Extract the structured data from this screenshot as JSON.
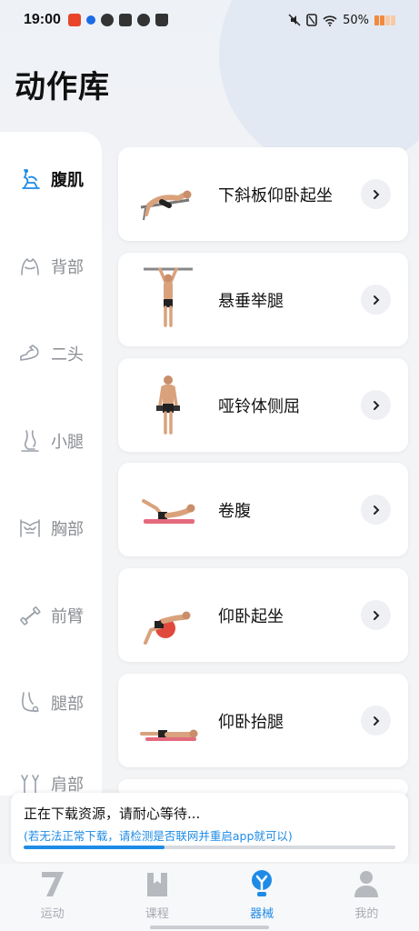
{
  "status_bar": {
    "time": "19:00",
    "battery": "50%"
  },
  "page": {
    "title": "动作库"
  },
  "categories": [
    {
      "label": "腹肌",
      "icon": "abs-icon",
      "active": true
    },
    {
      "label": "背部",
      "icon": "back-icon",
      "active": false
    },
    {
      "label": "二头",
      "icon": "biceps-icon",
      "active": false
    },
    {
      "label": "小腿",
      "icon": "calf-icon",
      "active": false
    },
    {
      "label": "胸部",
      "icon": "chest-icon",
      "active": false
    },
    {
      "label": "前臂",
      "icon": "forearm-icon",
      "active": false
    },
    {
      "label": "腿部",
      "icon": "leg-icon",
      "active": false
    },
    {
      "label": "肩部",
      "icon": "shoulder-icon",
      "active": false
    }
  ],
  "exercises": [
    {
      "name": "下斜板仰卧起坐",
      "thumb": "decline-situp-figure"
    },
    {
      "name": "悬垂举腿",
      "thumb": "hanging-leg-raise-figure"
    },
    {
      "name": "哑铃体侧屈",
      "thumb": "dumbbell-side-bend-figure"
    },
    {
      "name": "卷腹",
      "thumb": "crunch-figure"
    },
    {
      "name": "仰卧起坐",
      "thumb": "ball-situp-figure"
    },
    {
      "name": "仰卧抬腿",
      "thumb": "lying-leg-raise-figure"
    }
  ],
  "download": {
    "title": "正在下载资源，请耐心等待...",
    "hint": "(若无法正常下载，请检测是否联网并重启app就可以)",
    "progress": 0.38
  },
  "nav": [
    {
      "label": "运动",
      "icon": "sport-icon",
      "active": false
    },
    {
      "label": "课程",
      "icon": "course-icon",
      "active": false
    },
    {
      "label": "器械",
      "icon": "equipment-icon",
      "active": true
    },
    {
      "label": "我的",
      "icon": "profile-icon",
      "active": false
    }
  ],
  "colors": {
    "accent": "#1e8be6",
    "inactive": "#a7abb1",
    "battery": "#f08a3c"
  }
}
